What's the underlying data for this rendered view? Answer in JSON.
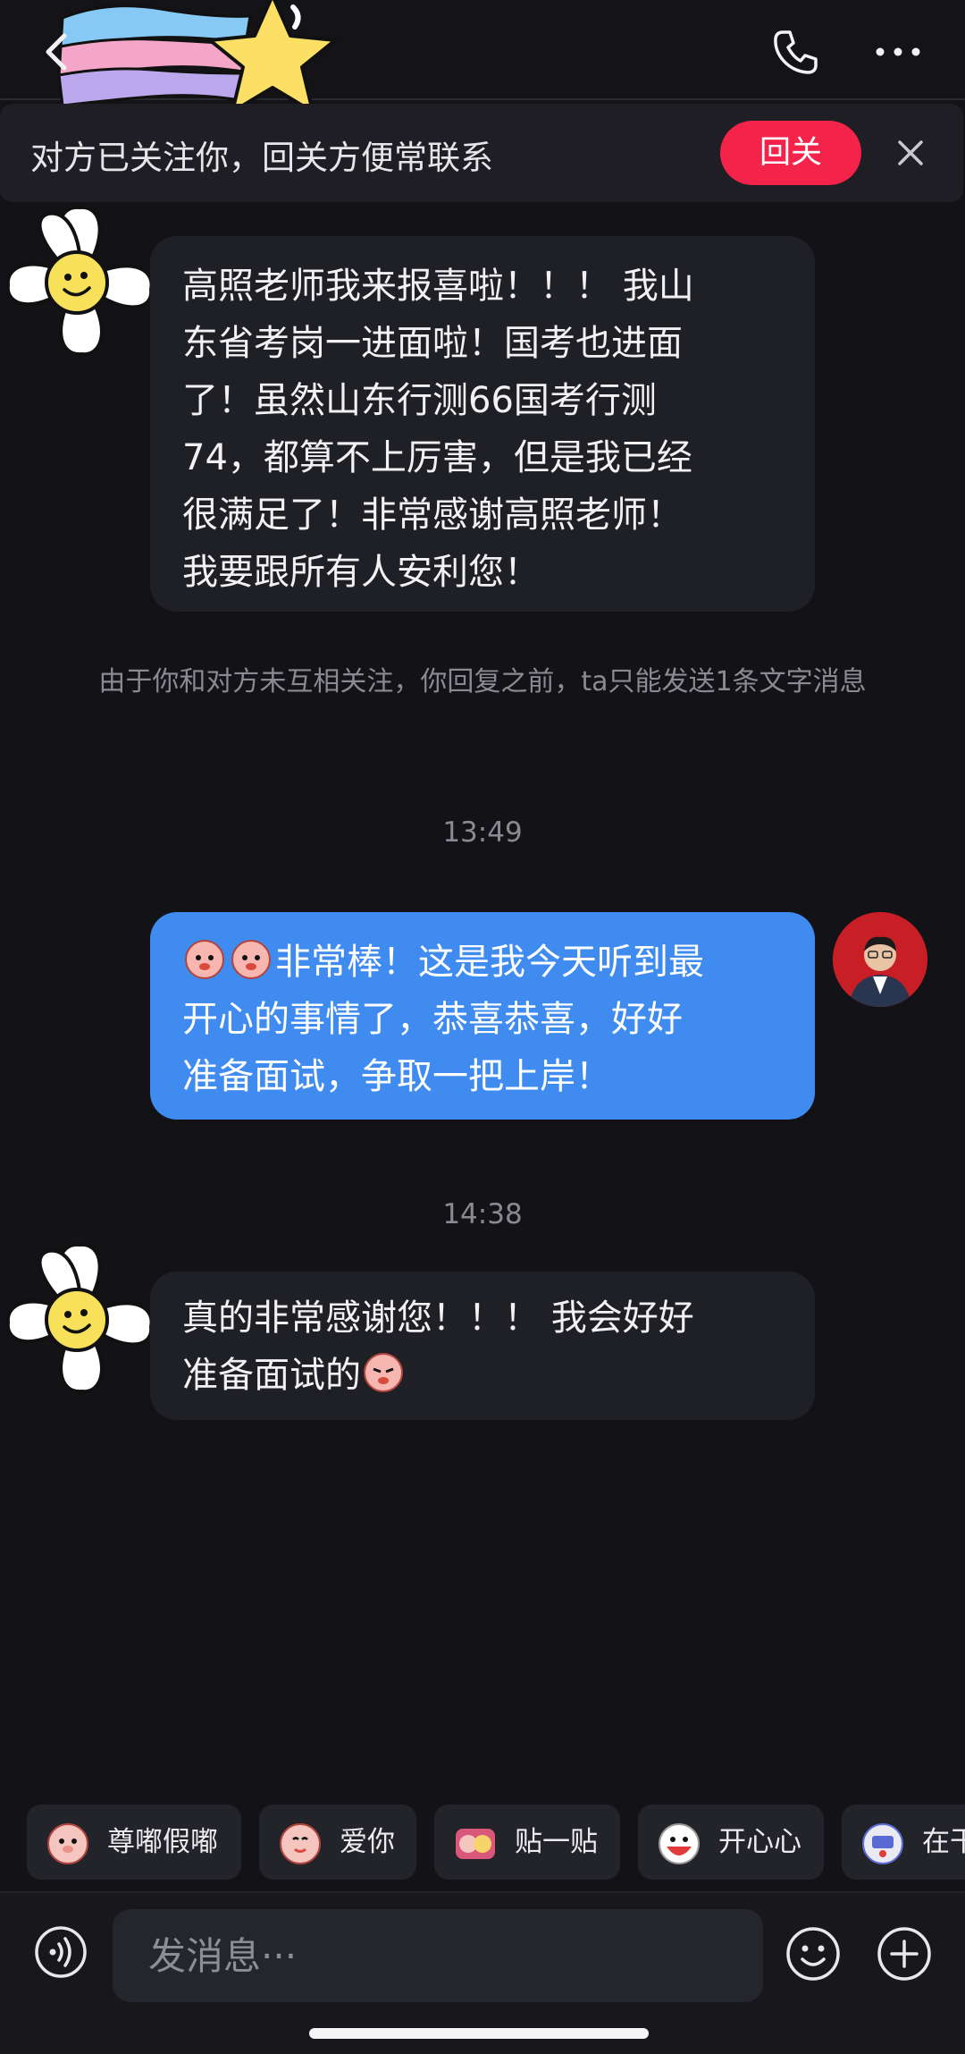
{
  "header": {
    "back_icon": "chevron-left-icon",
    "call_icon": "phone-icon",
    "more_icon": "more-horizontal-icon"
  },
  "banner": {
    "text": "对方已关注你，回关方便常联系",
    "follow_label": "回关",
    "close_icon": "close-icon"
  },
  "messages": [
    {
      "direction": "incoming",
      "lines": [
        "高照老师我来报喜啦！！！ 我山",
        "东省考岗一进面啦！国考也进面",
        "了！虽然山东行测66国考行测",
        "74，都算不上厉害，但是我已经",
        "很满足了！非常感谢高照老师！",
        "我要跟所有人安利您！"
      ]
    },
    {
      "direction": "outgoing",
      "lines": [
        "非常棒！这是我今天听到最",
        "开心的事情了，恭喜恭喜，好好",
        "准备面试，争取一把上岸！"
      ]
    },
    {
      "direction": "incoming",
      "lines": [
        "真的非常感谢您！！！ 我会好好",
        "准备面试的"
      ]
    }
  ],
  "system_note": "由于你和对方未互相关注，你回复之前，ta只能发送1条文字消息",
  "timestamps": [
    "13:49",
    "14:38"
  ],
  "quick_stickers": [
    {
      "label": "尊嘟假嘟",
      "icon": "sticker-pig-icon"
    },
    {
      "label": "爱你",
      "icon": "sticker-love-icon"
    },
    {
      "label": "贴一贴",
      "icon": "sticker-hug-icon"
    },
    {
      "label": "开心心",
      "icon": "sticker-happy-icon"
    },
    {
      "label": "在干",
      "icon": "sticker-busy-icon"
    }
  ],
  "input": {
    "placeholder": "发消息···",
    "voice_icon": "voice-icon",
    "emoji_icon": "emoji-icon",
    "plus_icon": "plus-icon"
  },
  "colors": {
    "background": "#121217",
    "accent_red": "#f3234a",
    "outgoing_bubble": "#3f8bf0",
    "incoming_bubble": "#1f1f26"
  }
}
